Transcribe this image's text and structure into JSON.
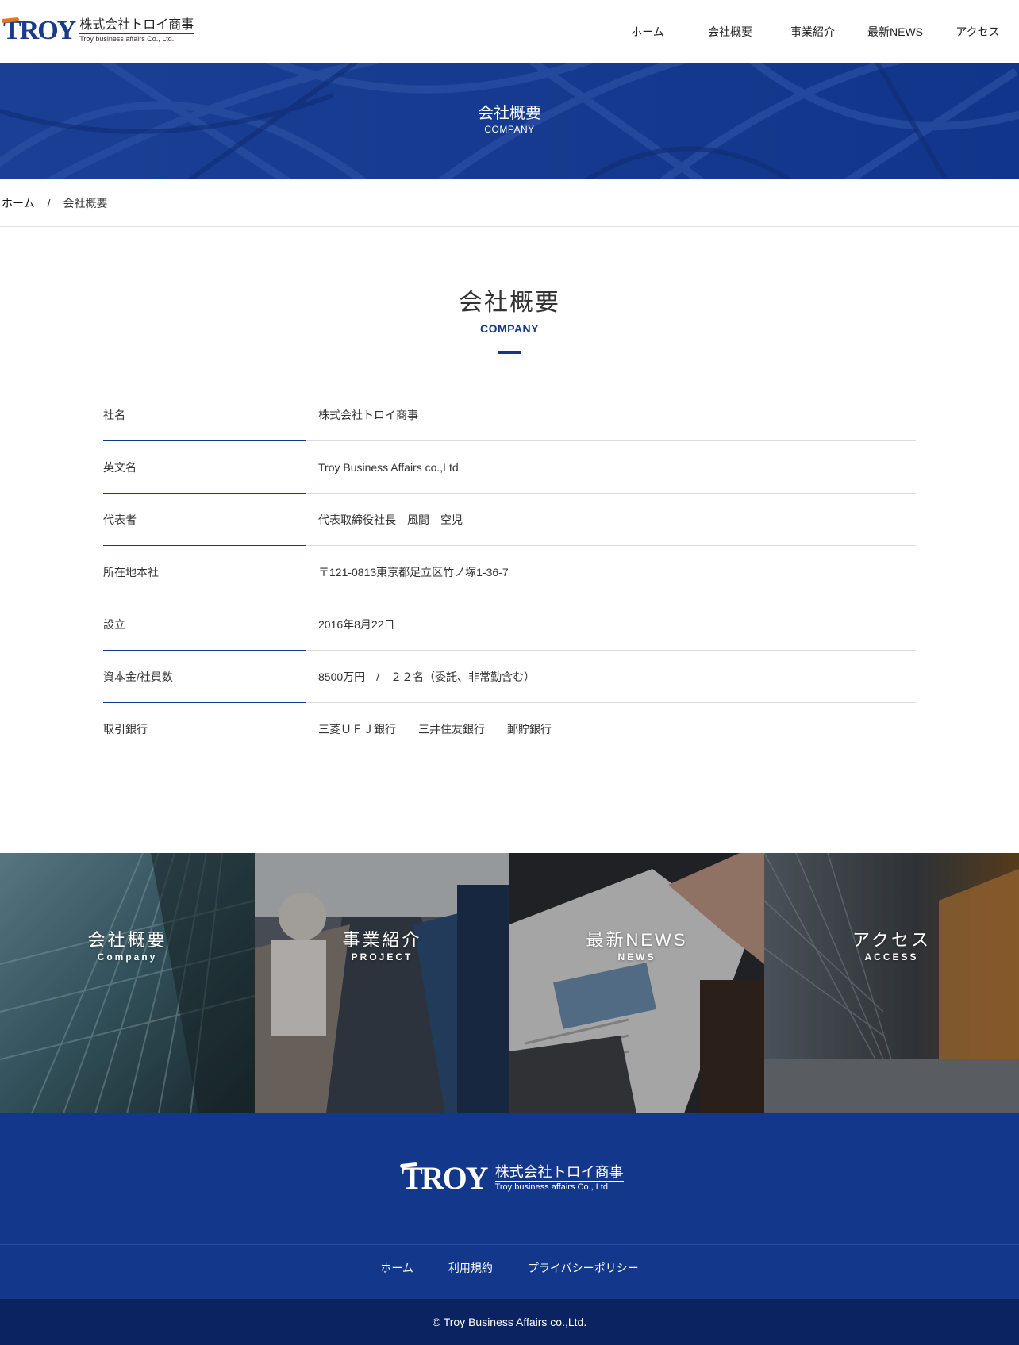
{
  "header": {
    "logo_mark": "TROY",
    "logo_jp": "株式会社トロイ商事",
    "logo_en": "Troy business affairs Co., Ltd.",
    "nav": [
      "ホーム",
      "会社概要",
      "事業紹介",
      "最新NEWS",
      "アクセス"
    ]
  },
  "banner": {
    "title": "会社概要",
    "subtitle": "COMPANY"
  },
  "breadcrumb": {
    "home": "ホーム",
    "separator": "/",
    "current": "会社概要"
  },
  "section": {
    "title": "会社概要",
    "subtitle": "COMPANY"
  },
  "company_info": [
    {
      "label": "社名",
      "value": "株式会社トロイ商事"
    },
    {
      "label": "英文名",
      "value": "Troy Business Affairs co.,Ltd."
    },
    {
      "label": "代表者",
      "value": "代表取締役社長　風間　空児"
    },
    {
      "label": "所在地本社",
      "value": "〒121-0813東京都足立区竹ノ塚1-36-7"
    },
    {
      "label": "設立",
      "value": "2016年8月22日"
    },
    {
      "label": "資本金/社員数",
      "value": "8500万円　/　２２名（委託、非常勤含む）"
    },
    {
      "label": "取引銀行",
      "value": "三菱ＵＦＪ銀行　　三井住友銀行　　郵貯銀行"
    }
  ],
  "tiles": [
    {
      "title": "会社概要",
      "subtitle": "Company"
    },
    {
      "title": "事業紹介",
      "subtitle": "PROJECT"
    },
    {
      "title": "最新NEWS",
      "subtitle": "NEWS"
    },
    {
      "title": "アクセス",
      "subtitle": "ACCESS"
    }
  ],
  "footer": {
    "logo_mark": "TROY",
    "logo_jp": "株式会社トロイ商事",
    "logo_en": "Troy business affairs Co., Ltd.",
    "links": [
      "ホーム",
      "利用規約",
      "プライバシーポリシー"
    ],
    "copyright": "© Troy Business Affairs co.,Ltd."
  },
  "colors": {
    "brand_blue": "#13378a",
    "brand_orange": "#e07820",
    "copyright_bg": "#0b2461"
  }
}
